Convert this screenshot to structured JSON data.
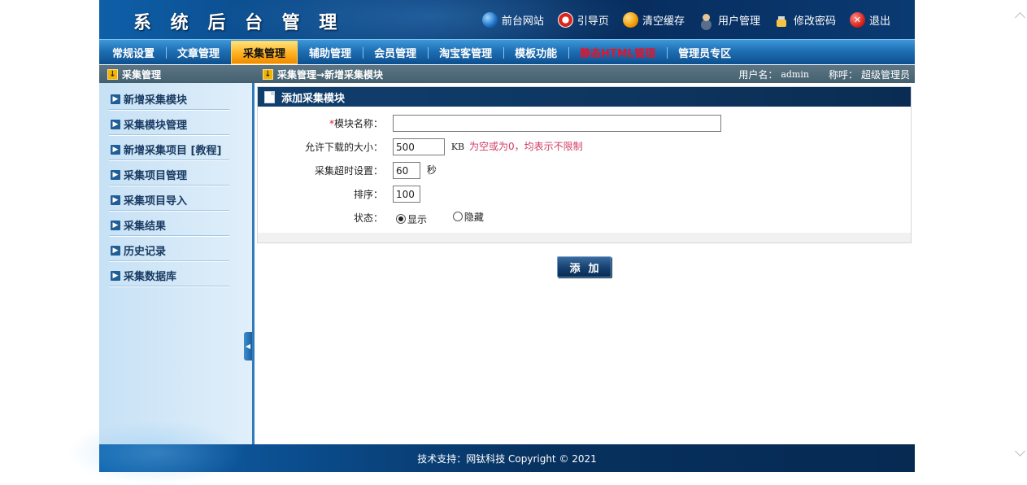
{
  "header": {
    "title": "系 统 后 台 管 理",
    "links": [
      {
        "label": "前台网站",
        "icon": "globe-icon"
      },
      {
        "label": "引导页",
        "icon": "lifebuoy-icon"
      },
      {
        "label": "清空缓存",
        "icon": "orange-ball-icon"
      },
      {
        "label": "用户管理",
        "icon": "user-icon"
      },
      {
        "label": "修改密码",
        "icon": "lock-icon"
      },
      {
        "label": "退出",
        "icon": "close-icon"
      }
    ]
  },
  "nav": {
    "items": [
      {
        "label": "常规设置"
      },
      {
        "label": "文章管理"
      },
      {
        "label": "采集管理",
        "active": true
      },
      {
        "label": "辅助管理"
      },
      {
        "label": "会员管理"
      },
      {
        "label": "淘宝客管理"
      },
      {
        "label": "模板功能"
      },
      {
        "label": "静态HTML管理",
        "color": "#e4142a"
      },
      {
        "label": "管理员专区"
      }
    ]
  },
  "subbar": {
    "section": "采集管理",
    "breadcrumb": "采集管理→新增采集模块",
    "user_label": "用户名：",
    "user_value": "admin",
    "role_label": "称呼：",
    "role_value": "超级管理员"
  },
  "sidebar": {
    "items": [
      {
        "label": "新增采集模块"
      },
      {
        "label": "采集模块管理"
      },
      {
        "label": "新增采集项目 [教程]"
      },
      {
        "label": "采集项目管理"
      },
      {
        "label": "采集项目导入"
      },
      {
        "label": "采集结果"
      },
      {
        "label": "历史记录"
      },
      {
        "label": "采集数据库"
      }
    ]
  },
  "form": {
    "title": "添加采集模块",
    "name_required_mark": "*",
    "name_label": "模块名称：",
    "name_value": "",
    "size_label": "允许下载的大小：",
    "size_value": "500",
    "size_unit": "KB",
    "size_hint": "为空或为0，均表示不限制",
    "timeout_label": "采集超时设置：",
    "timeout_value": "60",
    "timeout_unit": "秒",
    "order_label": "排序：",
    "order_value": "100",
    "status_label": "状态：",
    "status_options": [
      "显示",
      "隐藏"
    ],
    "status_selected": "显示",
    "submit_label": "添加"
  },
  "footer": {
    "text": "技术支持：网钛科技  Copyright © 2021"
  },
  "colors": {
    "header_bg": "#0a3f7a",
    "nav_active": "#ffb020",
    "hint": "#d23a63",
    "accent_red": "#e4142a"
  }
}
